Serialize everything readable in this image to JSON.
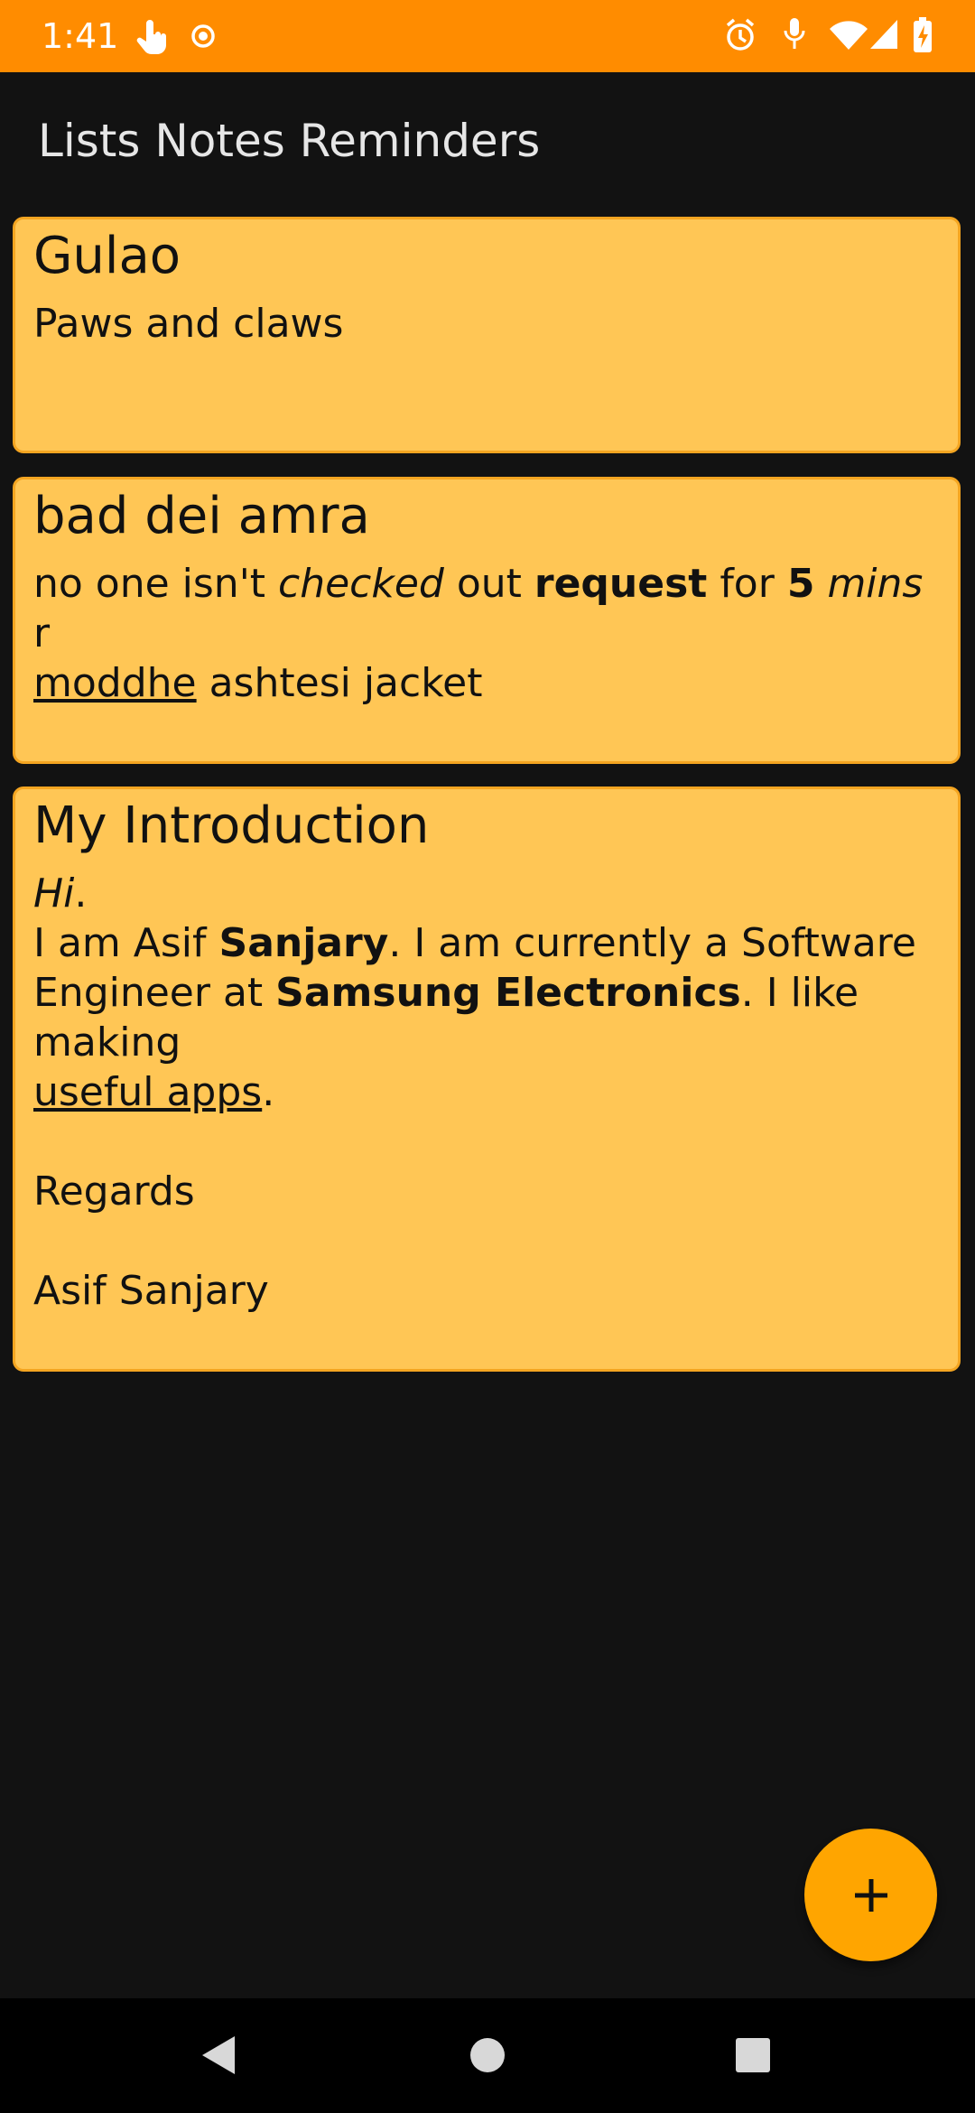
{
  "status_bar": {
    "time": "1:41",
    "left_icons": [
      "touch-icon",
      "record-icon"
    ],
    "right_icons": [
      "alarm-icon",
      "mic-icon",
      "wifi-icon",
      "signal-icon",
      "battery-charging-icon"
    ]
  },
  "app_bar": {
    "title": "Lists Notes Reminders"
  },
  "notes": [
    {
      "title": "Gulao",
      "body": "Paws and claws"
    },
    {
      "title": "bad dei amra",
      "body": {
        "seg0": "no one isn't ",
        "seg1": "checked",
        "seg2": " out ",
        "seg3": "request",
        "seg4": " for ",
        "seg5": "5",
        "seg6": " ",
        "seg7": "mins",
        "seg8": " r",
        "seg9": "moddhe",
        "seg10": " ashtesi jacket"
      }
    },
    {
      "title": "My Introduction",
      "body": {
        "hi": "Hi",
        "hi_dot": ".",
        "l2a": "I am Asif ",
        "l2b": "Sanjary",
        "l2c": ". I am currently a Software",
        "l3a": "Engineer at ",
        "l3b": "Samsung Electronics",
        "l3c": ". I like making",
        "l4a": "useful apps",
        "l4b": ".",
        "regards": "Regards",
        "signature": "Asif Sanjary"
      }
    }
  ],
  "fab": {
    "icon": "plus-icon"
  },
  "colors": {
    "status_bar": "#FF8C00",
    "background": "#121212",
    "card": "#FFC655",
    "card_border": "#F4A521",
    "fab": "#FFA500"
  }
}
